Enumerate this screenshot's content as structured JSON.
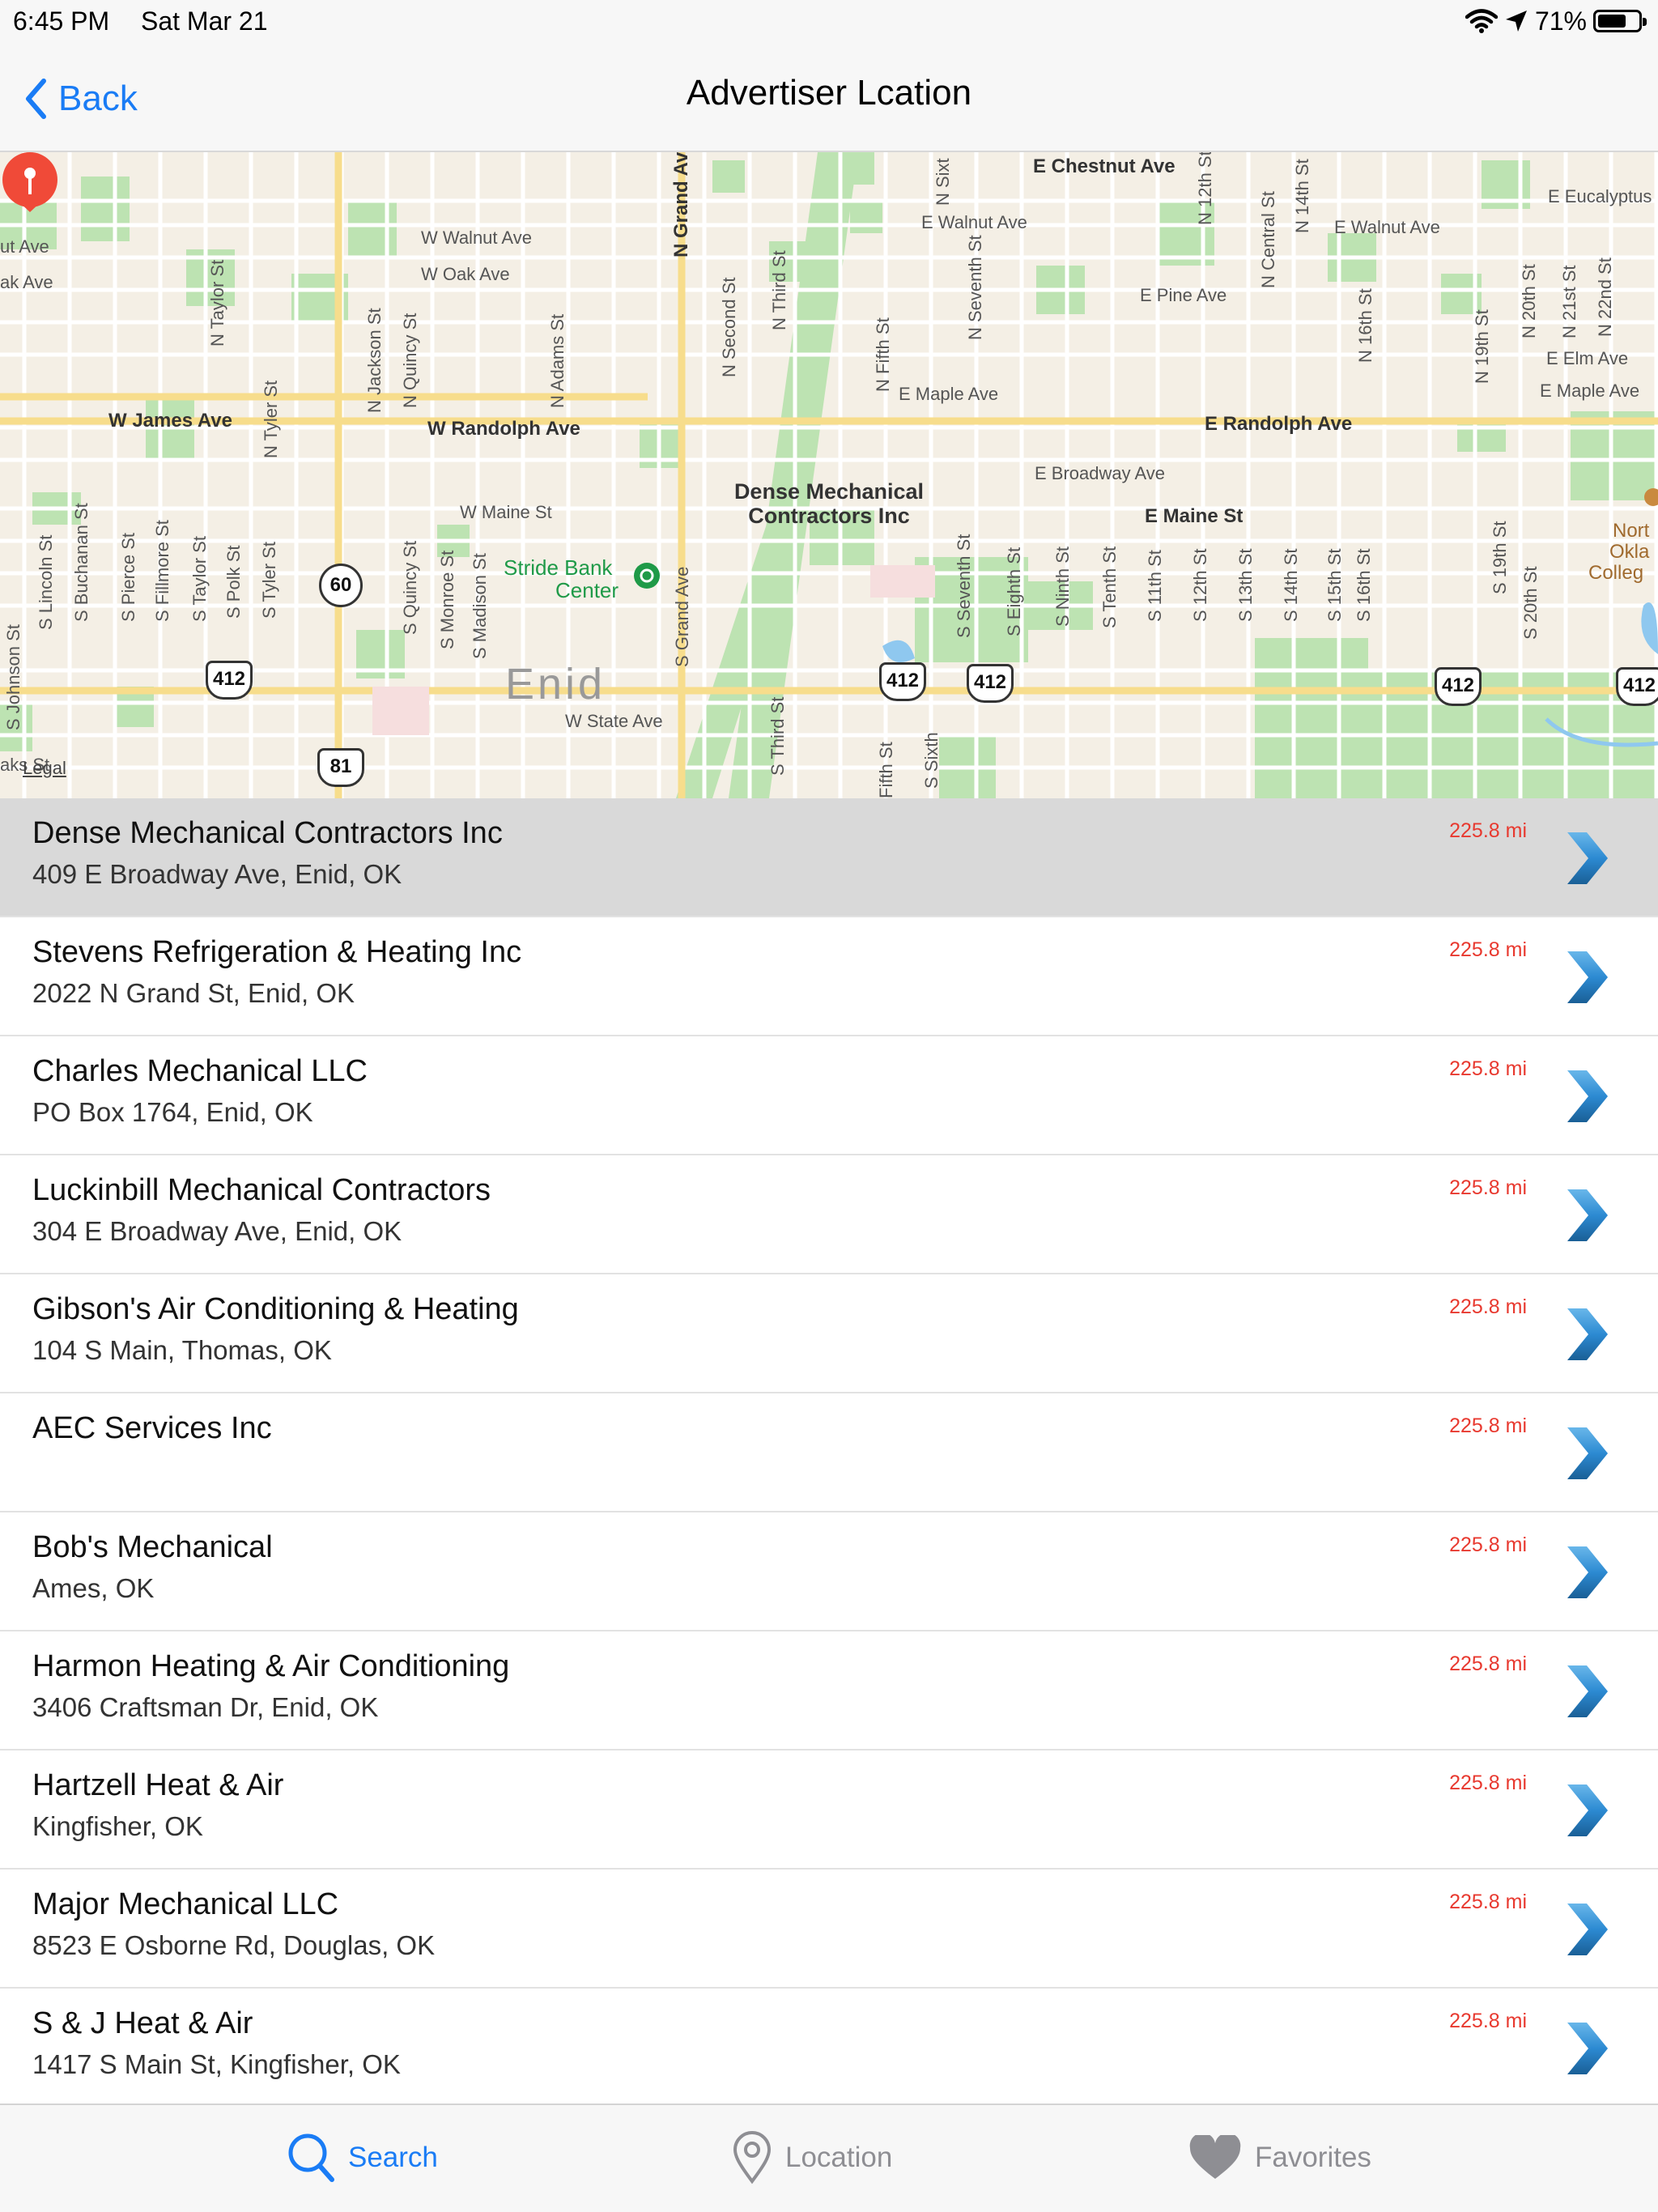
{
  "status_bar": {
    "time": "6:45 PM",
    "date": "Sat Mar 21",
    "battery": "71%",
    "battery_level": 0.71
  },
  "nav": {
    "back_label": "Back",
    "title": "Advertiser Lcation"
  },
  "map": {
    "city": "Enid",
    "legal": "Legal",
    "pin_label_line1": "Dense Mechanical",
    "pin_label_line2": "Contractors Inc",
    "poi_line1": "Stride Bank",
    "poi_line2": "Center",
    "college_line1": "Nort",
    "college_line2": "Okla",
    "college_line3": "Colleg",
    "streets_h": {
      "w_walnut": "W Walnut Ave",
      "w_oak": "W Oak Ave",
      "w_james": "W James Ave",
      "w_randolph": "W Randolph Ave",
      "w_maine": "W Maine St",
      "w_state": "W State Ave",
      "e_chestnut": "E Chestnut Ave",
      "e_walnut1": "E Walnut Ave",
      "e_walnut2": "E Walnut Ave",
      "e_pine": "E Pine Ave",
      "e_maple1": "E Maple Ave",
      "e_maple2": "E Maple Ave",
      "e_randolph": "E Randolph Ave",
      "e_broadway": "E Broadway Ave",
      "e_maine": "E Maine St",
      "e_elm": "E Elm Ave",
      "e_eucalyptus": "E Eucalyptus",
      "ut_ave": "ut Ave",
      "ak_ave": "ak Ave",
      "aks": "aks St"
    },
    "streets_v": {
      "n_grand": "N Grand Av",
      "n_taylor": "N Taylor St",
      "n_jackson": "N Jackson St",
      "n_quincy": "N Quincy St",
      "n_adams": "N Adams St",
      "n_tyler": "N Tyler St",
      "n_second": "N Second St",
      "n_third": "N Third St",
      "n_fifth": "N Fifth St",
      "n_sixth": "N Sixt",
      "n_seventh": "N Seventh St",
      "n_12th": "N 12th St",
      "n_central": "N Central St",
      "n_14th": "N 14th St",
      "n_16th": "N 16th St",
      "n_19th": "N 19th St",
      "n_20th": "N 20th St",
      "n_21st": "N 21st St",
      "n_22nd": "N 22nd St",
      "s_johnson": "S Johnson St",
      "s_lincoln": "S Lincoln St",
      "s_buchanan": "S Buchanan St",
      "s_pierce": "S Pierce St",
      "s_fillmore": "S Fillmore St",
      "s_taylor": "S Taylor St",
      "s_polk": "S Polk St",
      "s_tyler": "S Tyler St",
      "s_quincy": "S Quincy St",
      "s_monroe": "S Monroe St",
      "s_madison": "S Madison St",
      "s_grand": "S Grand Ave",
      "s_third": "S Third St",
      "s_fifth": "Fifth St",
      "s_sixth": "S Sixth",
      "s_seventh": "S Seventh St",
      "s_eighth": "S Eighth St",
      "s_ninth": "S Ninth St",
      "s_tenth": "S Tenth St",
      "s_11th": "S 11th St",
      "s_12th": "S 12th St",
      "s_13th": "S 13th St",
      "s_14th": "S 14th St",
      "s_15th": "S 15th St",
      "s_16th": "S 16th St",
      "s_19th": "S 19th St",
      "s_20th": "S 20th St"
    },
    "shields": {
      "us412a": "412",
      "us412b": "412",
      "us412c": "412",
      "us412d": "412",
      "us412e": "412",
      "sh60": "60",
      "us81": "81"
    }
  },
  "results": [
    {
      "name": "Dense Mechanical Contractors Inc",
      "address": "409 E Broadway Ave, Enid, OK",
      "distance": "225.8 mi"
    },
    {
      "name": "Stevens Refrigeration & Heating Inc",
      "address": "2022 N Grand St, Enid, OK",
      "distance": "225.8 mi"
    },
    {
      "name": "Charles Mechanical LLC",
      "address": "PO Box 1764, Enid, OK",
      "distance": "225.8 mi"
    },
    {
      "name": "Luckinbill Mechanical Contractors",
      "address": "304 E Broadway Ave, Enid, OK",
      "distance": "225.8 mi"
    },
    {
      "name": "Gibson's Air Conditioning & Heating",
      "address": "104 S Main, Thomas, OK",
      "distance": "225.8 mi"
    },
    {
      "name": "AEC Services Inc",
      "address": "",
      "distance": "225.8 mi"
    },
    {
      "name": "Bob's Mechanical",
      "address": "Ames, OK",
      "distance": "225.8 mi"
    },
    {
      "name": "Harmon Heating & Air Conditioning",
      "address": "3406 Craftsman Dr, Enid, OK",
      "distance": "225.8 mi"
    },
    {
      "name": "Hartzell Heat & Air",
      "address": "Kingfisher, OK",
      "distance": "225.8 mi"
    },
    {
      "name": "Major Mechanical LLC",
      "address": "8523 E Osborne Rd, Douglas, OK",
      "distance": "225.8 mi"
    },
    {
      "name": "S & J Heat & Air",
      "address": "1417 S Main St, Kingfisher, OK",
      "distance": "225.8 mi"
    }
  ],
  "tabs": {
    "search": "Search",
    "location": "Location",
    "favorites": "Favorites"
  },
  "colors": {
    "accent": "#1a7cf5",
    "distance": "#e8392f",
    "pin": "#f04a38",
    "selected_row": "#d9d9d9"
  }
}
